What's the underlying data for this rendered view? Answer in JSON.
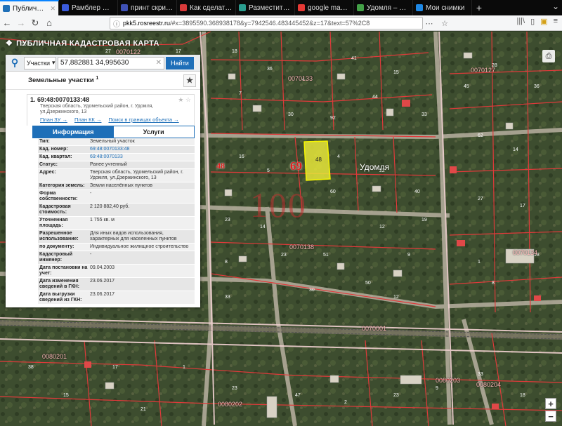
{
  "browser": {
    "tabs": [
      {
        "label": "Публичная када",
        "active": true,
        "color": "#1e6fb8"
      },
      {
        "label": "Рамблер — медиа",
        "active": false,
        "color": "#3b5bdb"
      },
      {
        "label": "принт скрин как",
        "active": false,
        "color": "#3f51b5"
      },
      {
        "label": "Как сделать скри",
        "active": false,
        "color": "#d83a3a"
      },
      {
        "label": "Разместить объя",
        "active": false,
        "color": "#2a9d8f"
      },
      {
        "label": "google maps — Я",
        "active": false,
        "color": "#e53935"
      },
      {
        "label": "Удомля – Google",
        "active": false,
        "color": "#43a047"
      },
      {
        "label": "Мои снимки",
        "active": false,
        "color": "#1e88e5"
      }
    ],
    "tab_close": "✕",
    "new_tab": "+",
    "url_host": "pkk5.rosreestr.ru",
    "url_rest": "/#x=3895590.368938178&y=7942546.483445452&z=17&text=57%2C8"
  },
  "site": {
    "title": "ПУБЛИЧНАЯ КАДАСТРОВАЯ КАРТА"
  },
  "search": {
    "type_label": "Участки",
    "query": "57,882881 34,995630",
    "button": "Найти"
  },
  "results": {
    "heading": "Земельные участки",
    "count": "1",
    "item": {
      "index": "1.",
      "cad_number": "69:48:0070133:48",
      "address_line1": "Тверская область, Удомельский район, г. Удомля,",
      "address_line2": "ул.Дзержинского, 13",
      "links": [
        "План ЗУ →",
        "План КК →",
        "Поиск в границах объекта →"
      ]
    },
    "tabs": [
      "Информация",
      "Услуги"
    ]
  },
  "properties": [
    {
      "key": "Тип:",
      "value": "Земельный участок"
    },
    {
      "key": "Кад. номер:",
      "value": "69:48:0070133:48",
      "link": true
    },
    {
      "key": "Кад. квартал:",
      "value": "69:48:0070133",
      "link": true
    },
    {
      "key": "Статус:",
      "value": "Ранее учтенный"
    },
    {
      "key": "Адрес:",
      "value": "Тверская область, Удомельский район, г. Удомля, ул.Дзержинского, 13"
    },
    {
      "key": "Категория земель:",
      "value": "Земли населённых пунктов"
    },
    {
      "key": "Форма собственности:",
      "value": "-"
    },
    {
      "key": "Кадастровая стоимость:",
      "value": "2 120 882,40 руб."
    },
    {
      "key": "Уточненная площадь:",
      "value": "1 755 кв. м"
    },
    {
      "key": "Разрешенное использование:",
      "value": "Для иных видов использования, характерных для населенных пунктов"
    },
    {
      "key": "по документу:",
      "value": "Индивидуальное жилищное строительство"
    },
    {
      "key": "Кадастровый инженер:",
      "value": "-"
    },
    {
      "key": "Дата постановки на учет:",
      "value": "09.04.2003"
    },
    {
      "key": "Дата изменения сведений в ГКН:",
      "value": "23.06.2017"
    },
    {
      "key": "Дата выгрузки сведений из ГКН:",
      "value": "23.06.2017"
    }
  ],
  "map": {
    "city": "Удомля",
    "zone": "69",
    "zone2": "48",
    "district": "100",
    "parcel_label": "48",
    "parcel_color": "#e8e83a",
    "quarters": [
      "0070122",
      "0070133",
      "0070127",
      "0070138",
      "0070134",
      "0070001",
      "0080201",
      "0080202",
      "0080203",
      "0080204"
    ]
  },
  "icons": {
    "search": "search-icon",
    "star": "star-icon",
    "zoom_in": "+",
    "zoom_out": "−"
  }
}
